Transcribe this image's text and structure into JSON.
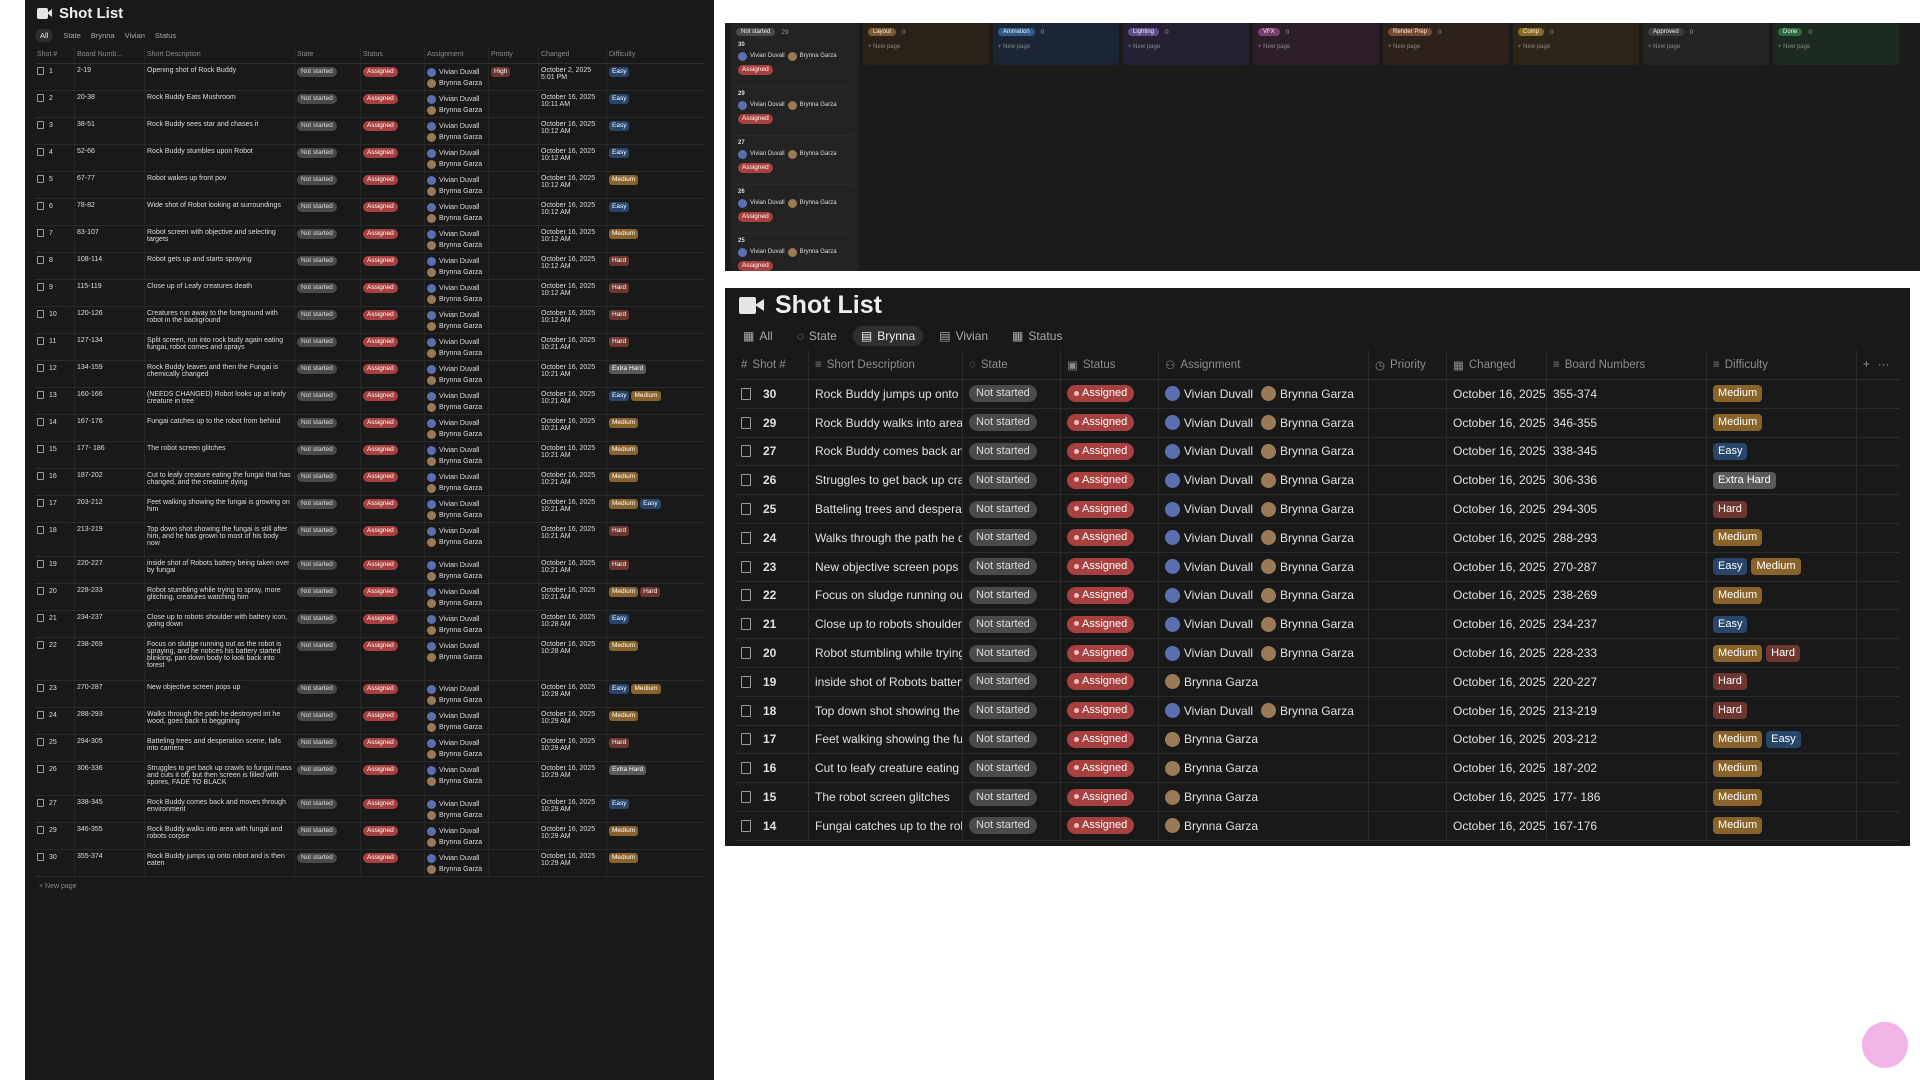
{
  "p1": {
    "title": "Shot List",
    "tabs": [
      "All",
      "State",
      "Brynna",
      "Vivian",
      "Status"
    ],
    "headers": [
      "Shot #",
      "Board Numb...",
      "Short Description",
      "State",
      "Status",
      "Assignment",
      "Priority",
      "Changed",
      "Difficulty"
    ],
    "rows": [
      {
        "n": "1",
        "b": "2-19",
        "d": "Opening shot of Rock Buddy",
        "p": "High",
        "c": "October 2, 2025 5:01 PM",
        "diff": [
          "Easy"
        ]
      },
      {
        "n": "2",
        "b": "20-38",
        "d": "Rock Buddy Eats Mushroom",
        "p": "",
        "c": "October 16, 2025 10:11 AM",
        "diff": [
          "Easy"
        ]
      },
      {
        "n": "3",
        "b": "38-51",
        "d": "Rock Buddy sees star and chases it",
        "p": "",
        "c": "October 16, 2025 10:12 AM",
        "diff": [
          "Easy"
        ]
      },
      {
        "n": "4",
        "b": "52-66",
        "d": "Rock Buddy stumbles upon Robot",
        "p": "",
        "c": "October 16, 2025 10:12 AM",
        "diff": [
          "Easy"
        ]
      },
      {
        "n": "5",
        "b": "67-77",
        "d": "Robot wakes up front pov",
        "p": "",
        "c": "October 16, 2025 10:12 AM",
        "diff": [
          "Medium"
        ]
      },
      {
        "n": "6",
        "b": "78-82",
        "d": "Wide shot of Robot looking at surroundings",
        "p": "",
        "c": "October 16, 2025 10:12 AM",
        "diff": [
          "Easy"
        ]
      },
      {
        "n": "7",
        "b": "83-107",
        "d": "Robot screen with objective and selecting targets",
        "p": "",
        "c": "October 16, 2025 10:12 AM",
        "diff": [
          "Medium"
        ]
      },
      {
        "n": "8",
        "b": "108-114",
        "d": "Robot gets up and starts spraying",
        "p": "",
        "c": "October 16, 2025 10:12 AM",
        "diff": [
          "Hard"
        ]
      },
      {
        "n": "9",
        "b": "115-119",
        "d": "Close up of Leafy creatures death",
        "p": "",
        "c": "October 16, 2025 10:12 AM",
        "diff": [
          "Hard"
        ]
      },
      {
        "n": "10",
        "b": "120-126",
        "d": "Creatures run away to the foreground with robot in the background",
        "p": "",
        "c": "October 16, 2025 10:12 AM",
        "diff": [
          "Hard"
        ]
      },
      {
        "n": "11",
        "b": "127-134",
        "d": "Split screen, run into rock budy again eating fungai, robot comes and sprays",
        "p": "",
        "c": "October 16, 2025 10:21 AM",
        "diff": [
          "Hard"
        ]
      },
      {
        "n": "12",
        "b": "134-159",
        "d": "Rock Buddy leaves and then the Fungai is chemically changed",
        "p": "",
        "c": "October 16, 2025 10:21 AM",
        "diff": [
          "Extra Hard"
        ]
      },
      {
        "n": "13",
        "b": "160-166",
        "d": "(NEEDS CHANGED) Robot looks up at leafy creature in tree",
        "p": "",
        "c": "October 16, 2025 10:21 AM",
        "diff": [
          "Easy",
          "Medium"
        ]
      },
      {
        "n": "14",
        "b": "167-176",
        "d": "Fungai catches up to the robot from behind",
        "p": "",
        "c": "October 16, 2025 10:21 AM",
        "diff": [
          "Medium"
        ]
      },
      {
        "n": "15",
        "b": "177- 186",
        "d": "The robot screen glitches",
        "p": "",
        "c": "October 16, 2025 10:21 AM",
        "diff": [
          "Medium"
        ]
      },
      {
        "n": "16",
        "b": "187-202",
        "d": "Cut to leafy creature eating the fungai that has changed, and the creature dying",
        "p": "",
        "c": "October 16, 2025 10:21 AM",
        "diff": [
          "Medium"
        ]
      },
      {
        "n": "17",
        "b": "203-212",
        "d": "Feet walking showing the fungai is growing on him",
        "p": "",
        "c": "October 16, 2025 10:21 AM",
        "diff": [
          "Medium",
          "Easy"
        ]
      },
      {
        "n": "18",
        "b": "213-219",
        "d": "Top down shot showing the fungai is still after him, and he has grown to most of his body now",
        "p": "",
        "c": "October 16, 2025 10:21 AM",
        "diff": [
          "Hard"
        ]
      },
      {
        "n": "19",
        "b": "220-227",
        "d": "inside shot of Robots battery being taken over by fungai",
        "p": "",
        "c": "October 16, 2025 10:21 AM",
        "diff": [
          "Hard"
        ]
      },
      {
        "n": "20",
        "b": "228-233",
        "d": "Robot stumbling while trying to spray, more glitching, creatures watching him",
        "p": "",
        "c": "October 16, 2025 10:21 AM",
        "diff": [
          "Medium",
          "Hard"
        ]
      },
      {
        "n": "21",
        "b": "234-237",
        "d": "Close up to robots shoulder with battery icon, going down",
        "p": "",
        "c": "October 16, 2025 10:28 AM",
        "diff": [
          "Easy"
        ]
      },
      {
        "n": "22",
        "b": "238-269",
        "d": "Focus on sludge running out as the robot is spraying, and he notices his battery started blinking, pan down body to look back into forest",
        "p": "",
        "c": "October 16, 2025 10:28 AM",
        "diff": [
          "Medium"
        ]
      },
      {
        "n": "23",
        "b": "270-287",
        "d": "New objective screen pops up",
        "p": "",
        "c": "October 16, 2025 10:28 AM",
        "diff": [
          "Easy",
          "Medium"
        ]
      },
      {
        "n": "24",
        "b": "288-293",
        "d": "Walks through the path he destroyed int he wood, goes back to beggining",
        "p": "",
        "c": "October 16, 2025 10:29 AM",
        "diff": [
          "Medium"
        ]
      },
      {
        "n": "25",
        "b": "294-305",
        "d": "Batteling trees and desperation scene, falls into camera",
        "p": "",
        "c": "October 16, 2025 10:29 AM",
        "diff": [
          "Hard"
        ]
      },
      {
        "n": "26",
        "b": "306-336",
        "d": "Struggles to get back up crawls to fungai mass and cuts it off, but then screen is filled with spores, FADE TO BLACK",
        "p": "",
        "c": "October 16, 2025 10:29 AM",
        "diff": [
          "Extra Hard"
        ]
      },
      {
        "n": "27",
        "b": "338-345",
        "d": "Rock Buddy comes back and moves through environment",
        "p": "",
        "c": "October 16, 2025 10:29 AM",
        "diff": [
          "Easy"
        ]
      },
      {
        "n": "29",
        "b": "346-355",
        "d": "Rock Buddy walks into area with fungai and robots corpse",
        "p": "",
        "c": "October 16, 2025 10:29 AM",
        "diff": [
          "Medium"
        ]
      },
      {
        "n": "30",
        "b": "355-374",
        "d": "Rock Buddy jumps up onto robot and is then eaten",
        "p": "",
        "c": "October 16, 2025 10:29 AM",
        "diff": [
          "Medium"
        ]
      }
    ],
    "state_label": "Not started",
    "status_label": "Assigned",
    "assignee1": "Vivian Duvall",
    "assignee2": "Brynna Garza",
    "new_page": "+ New page"
  },
  "board": {
    "first": {
      "label": "Not started",
      "count": "29"
    },
    "columns": [
      {
        "label": "Layout",
        "count": "0",
        "color": "#7a5a2e"
      },
      {
        "label": "Animation",
        "count": "0",
        "color": "#2f5a8a"
      },
      {
        "label": "Lighting",
        "count": "0",
        "color": "#5f4c8a"
      },
      {
        "label": "VFX",
        "count": "0",
        "color": "#7a3f6a"
      },
      {
        "label": "Render Prep",
        "count": "0",
        "color": "#7a4a2e"
      },
      {
        "label": "Comp",
        "count": "0",
        "color": "#8a6a1e"
      },
      {
        "label": "Approved",
        "count": "0",
        "color": "#3e3e3e"
      },
      {
        "label": "Done",
        "count": "0",
        "color": "#2e6a42"
      }
    ],
    "col_bg": [
      "#2a2218",
      "#1c2533",
      "#262033",
      "#2d1f29",
      "#2d221b",
      "#2d2618",
      "#242424",
      "#1c2a20"
    ],
    "new_page": "+ New page",
    "cards": [
      "30",
      "29",
      "27",
      "26",
      "25"
    ],
    "card_tag": "Assigned"
  },
  "p3": {
    "title": "Shot List",
    "tabs": [
      "All",
      "State",
      "Brynna",
      "Vivian",
      "Status"
    ],
    "headers": [
      "Shot #",
      "Short Description",
      "State",
      "Status",
      "Assignment",
      "Priority",
      "Changed",
      "Board Numbers",
      "Difficulty"
    ],
    "rows": [
      {
        "n": "30",
        "d": "Rock Buddy jumps up onto rob",
        "a": 2,
        "c": "October 16, 2025 1(",
        "b": "355-374",
        "diff": [
          "Medium"
        ]
      },
      {
        "n": "29",
        "d": "Rock Buddy walks into area wit",
        "a": 2,
        "c": "October 16, 2025 1(",
        "b": "346-355",
        "diff": [
          "Medium"
        ]
      },
      {
        "n": "27",
        "d": "Rock Buddy comes back and m",
        "a": 2,
        "c": "October 16, 2025 1(",
        "b": "338-345",
        "diff": [
          "Easy"
        ]
      },
      {
        "n": "26",
        "d": "Struggles to get back up crawls",
        "a": 2,
        "c": "October 16, 2025 1(",
        "b": "306-336",
        "diff": [
          "Extra Hard"
        ]
      },
      {
        "n": "25",
        "d": "Batteling trees and desperatior",
        "a": 2,
        "c": "October 16, 2025 1(",
        "b": "294-305",
        "diff": [
          "Hard"
        ]
      },
      {
        "n": "24",
        "d": "Walks through the path he dest",
        "a": 2,
        "c": "October 16, 2025 1(",
        "b": "288-293",
        "diff": [
          "Medium"
        ]
      },
      {
        "n": "23",
        "d": "New objective screen pops up",
        "a": 2,
        "c": "October 16, 2025 1(",
        "b": "270-287",
        "diff": [
          "Easy",
          "Medium"
        ]
      },
      {
        "n": "22",
        "d": "Focus on sludge running out as",
        "a": 2,
        "c": "October 16, 2025 1(",
        "b": "238-269",
        "diff": [
          "Medium"
        ]
      },
      {
        "n": "21",
        "d": "Close up to robots shoulder wi",
        "a": 2,
        "c": "October 16, 2025 1(",
        "b": "234-237",
        "diff": [
          "Easy"
        ]
      },
      {
        "n": "20",
        "d": "Robot stumbling while trying tc",
        "a": 2,
        "c": "October 16, 2025 1(",
        "b": "228-233",
        "diff": [
          "Medium",
          "Hard"
        ]
      },
      {
        "n": "19",
        "d": "inside shot of Robots battery b",
        "a": 1,
        "c": "October 16, 2025 1(",
        "b": "220-227",
        "diff": [
          "Hard"
        ]
      },
      {
        "n": "18",
        "d": "Top down shot showing the fur",
        "a": 2,
        "c": "October 16, 2025 1(",
        "b": "213-219",
        "diff": [
          "Hard"
        ]
      },
      {
        "n": "17",
        "d": "Feet walking showing the fungi",
        "a": 1,
        "c": "October 16, 2025 1(",
        "b": "203-212",
        "diff": [
          "Medium",
          "Easy"
        ]
      },
      {
        "n": "16",
        "d": "Cut to leafy creature eating the",
        "a": 1,
        "c": "October 16, 2025 1(",
        "b": "187-202",
        "diff": [
          "Medium"
        ]
      },
      {
        "n": "15",
        "d": "The robot screen glitches",
        "a": 1,
        "c": "October 16, 2025 1(",
        "b": "177- 186",
        "diff": [
          "Medium"
        ]
      },
      {
        "n": "14",
        "d": "Fungai catches up to the robot",
        "a": 1,
        "c": "October 16, 2025 1(",
        "b": "167-176",
        "diff": [
          "Medium"
        ]
      }
    ],
    "state_label": "Not started",
    "status_label": "Assigned",
    "assignee1": "Vivian Duvall",
    "assignee2": "Brynna Garza",
    "add": "+",
    "more": "···"
  }
}
